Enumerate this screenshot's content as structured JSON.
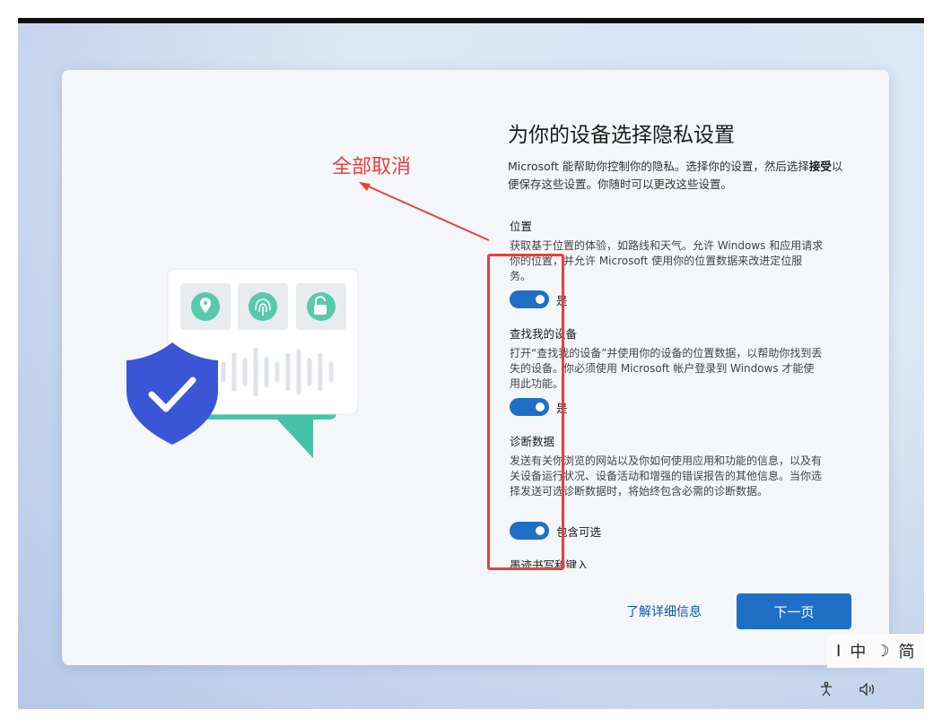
{
  "colors": {
    "accent": "#1f6fc6",
    "annotation": "#e8403a",
    "link": "#0b5ba8"
  },
  "page": {
    "title": "为你的设备选择隐私设置",
    "intro_part1": "Microsoft 能帮助你控制你的隐私。选择你的设置，然后选择",
    "intro_bold": "接受",
    "intro_part2": "以便保存这些设置。你随时可以更改这些设置。"
  },
  "sections": [
    {
      "title": "位置",
      "description": "获取基于位置的体验，如路线和天气。允许 Windows 和应用请求你的位置，并允许 Microsoft 使用你的位置数据来改进定位服务。",
      "toggle_on": true,
      "toggle_label": "是"
    },
    {
      "title": "查找我的设备",
      "description": "打开“查找我的设备”并使用你的设备的位置数据，以帮助你找到丢失的设备。你必须使用 Microsoft 帐户登录到 Windows 才能使用此功能。",
      "toggle_on": true,
      "toggle_label": "是"
    },
    {
      "title": "诊断数据",
      "description": "发送有关你浏览的网站以及你如何使用应用和功能的信息，以及有关设备运行状况、设备活动和增强的错误报告的其他信息。当你选择发送可选诊断数据时，将始终包含必需的诊断数据。",
      "toggle_on": true,
      "toggle_label": "包含可选"
    },
    {
      "title": "墨迹书写和键入"
    }
  ],
  "footer": {
    "learn_more": "了解详细信息",
    "next_button": "下一页"
  },
  "annotation": {
    "text": "全部取消"
  },
  "taskbar": {
    "ime_cursor": "I",
    "ime_mode": "中",
    "ime_moon": "☽",
    "ime_trad": "简",
    "tray_accessibility": "accessibility-icon",
    "tray_volume": "volume-icon"
  }
}
